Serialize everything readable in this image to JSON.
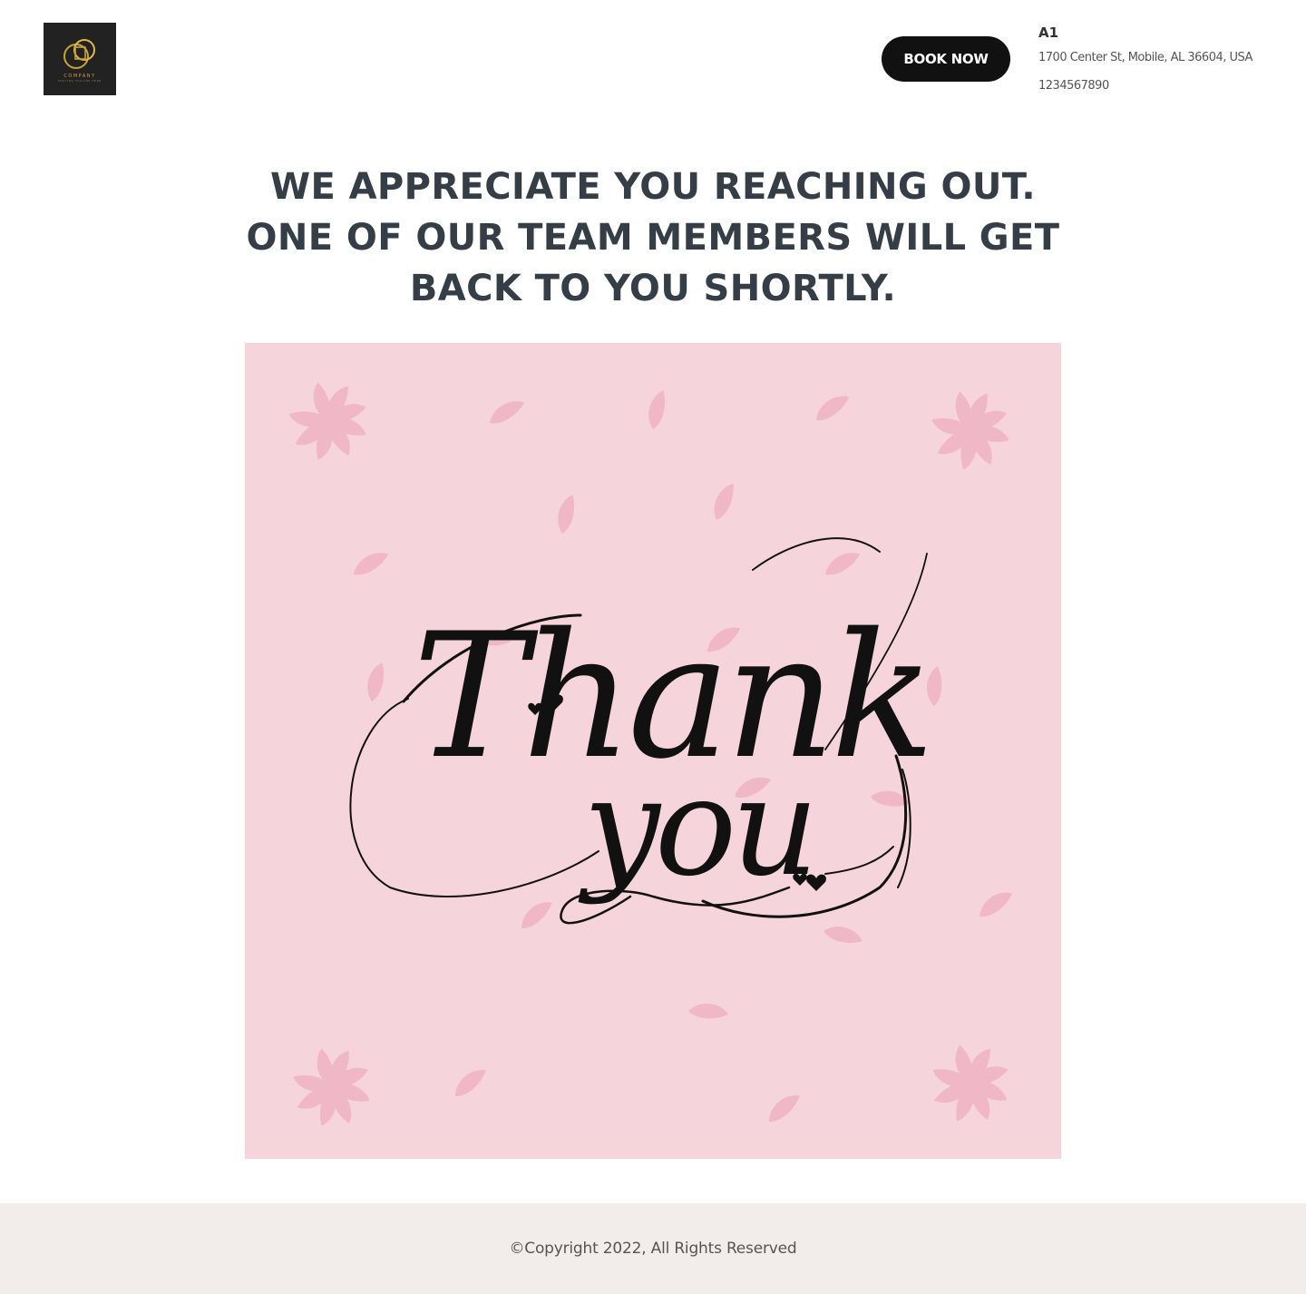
{
  "header": {
    "logo": {
      "icon": "interlocking-rings-logo-icon",
      "word": "COMPANY",
      "tagline": "WRITING TAGLINE HERE"
    },
    "book_button_label": "BOOK NOW",
    "contact": {
      "name": "A1",
      "address": "1700 Center St, Mobile, AL 36604, USA",
      "phone": "1234567890"
    }
  },
  "main": {
    "headline_lines": [
      "WE APPRECIATE YOU REACHING OUT.",
      "ONE OF OUR TEAM MEMBERS WILL GET",
      "BACK TO YOU SHORTLY."
    ],
    "image": {
      "icon": "thank-you-card-illustration",
      "script_line_1": "Thank",
      "script_line_2": "you",
      "background": "#f6d4dc",
      "petal_color": "#f0b4c4"
    }
  },
  "footer": {
    "copyright": "©Copyright 2022, All Rights Reserved"
  },
  "colors": {
    "heading": "#353d47",
    "button_bg": "#111111",
    "footer_bg": "#f2ecea",
    "logo_gold": "#c9a23a"
  }
}
